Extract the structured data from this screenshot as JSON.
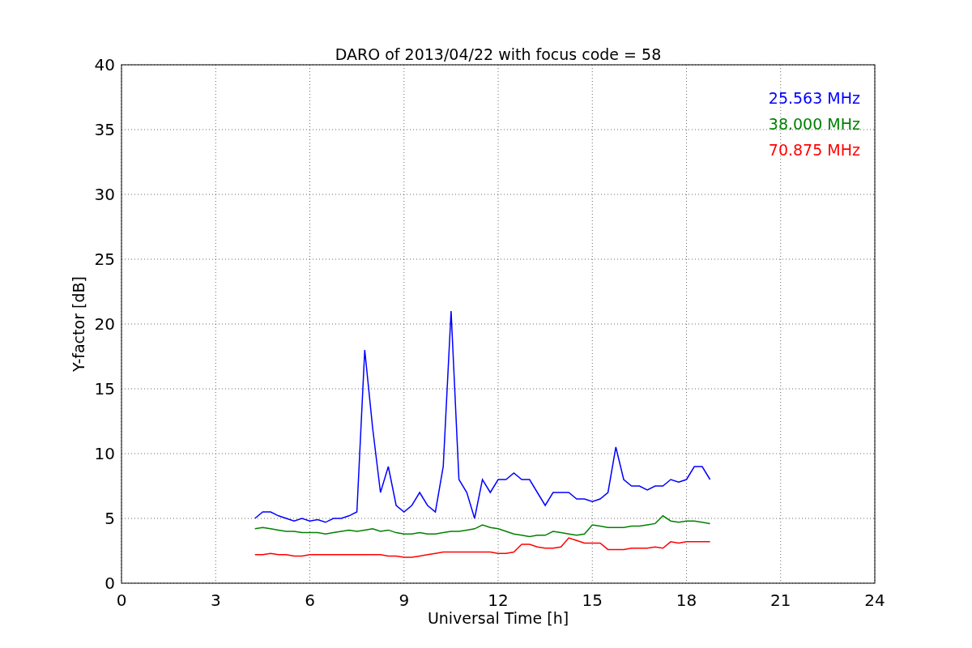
{
  "chart": {
    "chart_data": {
      "type": "line",
      "title": "DARO of 2013/04/22 with focus code = 58",
      "xlabel": "Universal Time [h]",
      "ylabel": "Y-factor [dB]",
      "x": [
        4.25,
        4.5,
        4.75,
        5,
        5.25,
        5.5,
        5.75,
        6,
        6.25,
        6.5,
        6.75,
        7,
        7.25,
        7.5,
        7.75,
        8,
        8.25,
        8.5,
        8.75,
        9,
        9.25,
        9.5,
        9.75,
        10,
        10.25,
        10.5,
        10.75,
        11,
        11.25,
        11.5,
        11.75,
        12,
        12.25,
        12.5,
        12.75,
        13,
        13.25,
        13.5,
        13.75,
        14,
        14.25,
        14.5,
        14.75,
        15,
        15.25,
        15.5,
        15.75,
        16,
        16.25,
        16.5,
        16.75,
        17,
        17.25,
        17.5,
        17.75,
        18,
        18.25,
        18.5,
        18.75
      ],
      "series": [
        {
          "name": "25.563 MHz",
          "color": "#0000ff",
          "values": [
            5,
            5.5,
            5.5,
            5.2,
            5,
            4.8,
            5,
            4.8,
            4.9,
            4.7,
            5,
            5,
            5.2,
            5.5,
            18,
            12,
            7,
            9,
            6,
            5.5,
            6,
            7,
            6,
            5.5,
            9,
            21,
            8,
            7,
            5,
            8,
            7,
            8,
            8,
            8.5,
            8,
            8,
            7,
            6,
            7,
            7,
            7,
            6.5,
            6.5,
            6.3,
            6.5,
            7,
            10.5,
            8,
            7.5,
            7.5,
            7.2,
            7.5,
            7.5,
            8,
            7.8,
            8,
            9,
            9,
            8
          ]
        },
        {
          "name": "38.000 MHz",
          "color": "#008000",
          "values": [
            4.2,
            4.3,
            4.2,
            4.1,
            4,
            4,
            3.9,
            3.9,
            3.9,
            3.8,
            3.9,
            4,
            4.1,
            4,
            4.1,
            4.2,
            4,
            4.1,
            3.9,
            3.8,
            3.8,
            3.9,
            3.8,
            3.8,
            3.9,
            4,
            4,
            4.1,
            4.2,
            4.5,
            4.3,
            4.2,
            4,
            3.8,
            3.7,
            3.6,
            3.7,
            3.7,
            4,
            3.9,
            3.8,
            3.7,
            3.8,
            4.5,
            4.4,
            4.3,
            4.3,
            4.3,
            4.4,
            4.4,
            4.5,
            4.6,
            5.2,
            4.8,
            4.7,
            4.8,
            4.8,
            4.7,
            4.6
          ]
        },
        {
          "name": "70.875 MHz",
          "color": "#ff0000",
          "values": [
            2.2,
            2.2,
            2.3,
            2.2,
            2.2,
            2.1,
            2.1,
            2.2,
            2.2,
            2.2,
            2.2,
            2.2,
            2.2,
            2.2,
            2.2,
            2.2,
            2.2,
            2.1,
            2.1,
            2,
            2,
            2.1,
            2.2,
            2.3,
            2.4,
            2.4,
            2.4,
            2.4,
            2.4,
            2.4,
            2.4,
            2.3,
            2.3,
            2.4,
            3,
            3,
            2.8,
            2.7,
            2.7,
            2.8,
            3.5,
            3.3,
            3.1,
            3.1,
            3.1,
            2.6,
            2.6,
            2.6,
            2.7,
            2.7,
            2.7,
            2.8,
            2.7,
            3.2,
            3.1,
            3.2,
            3.2,
            3.2,
            3.2
          ]
        }
      ],
      "xlim": [
        0,
        24
      ],
      "ylim": [
        0,
        40
      ],
      "xticks": [
        0,
        3,
        6,
        9,
        12,
        15,
        18,
        21,
        24
      ],
      "yticks": [
        0,
        5,
        10,
        15,
        20,
        25,
        30,
        35,
        40
      ],
      "grid": true
    }
  }
}
